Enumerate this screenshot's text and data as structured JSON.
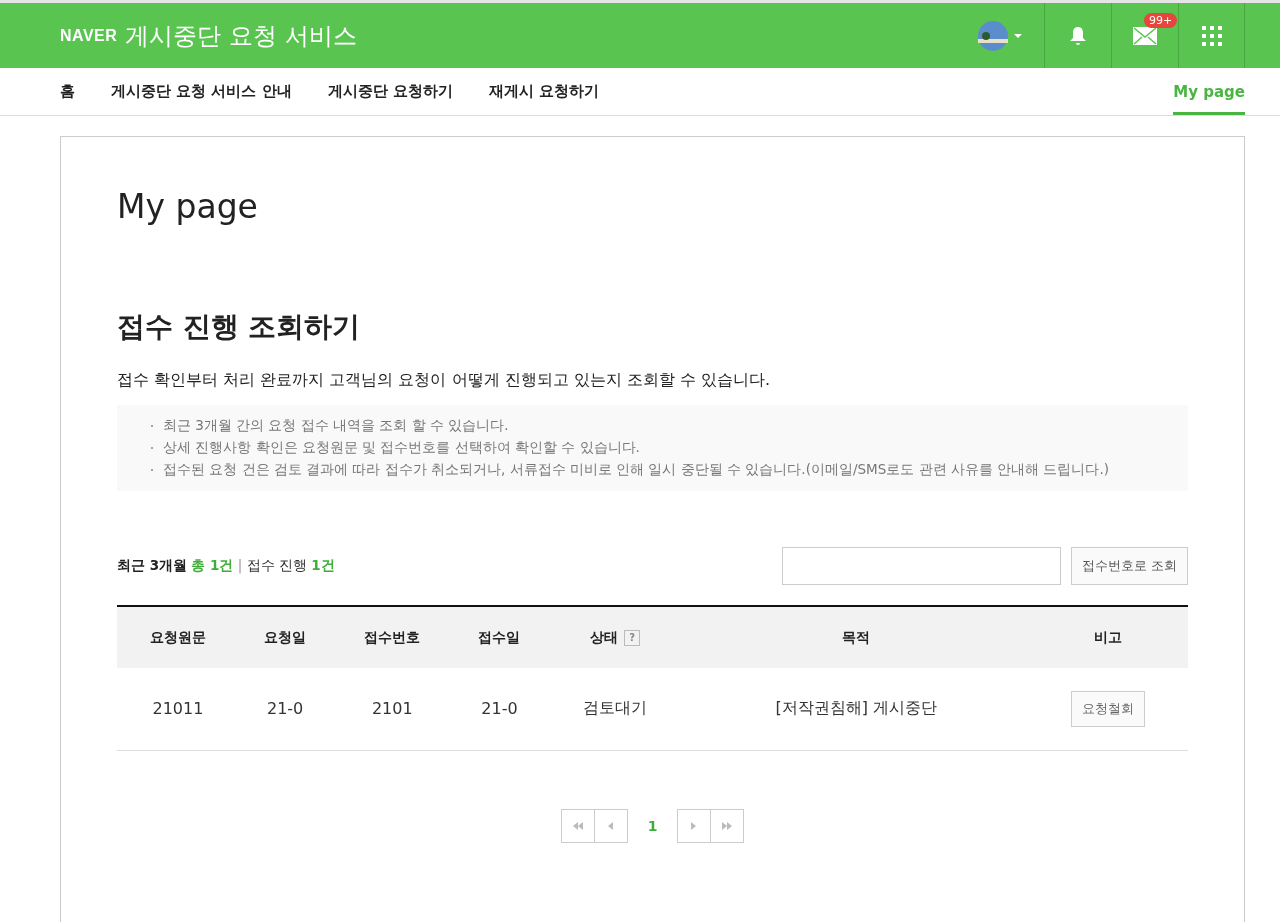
{
  "header": {
    "logo": "NAVER",
    "title": "게시중단 요청 서비스",
    "mail_badge": "99+"
  },
  "nav": {
    "items": [
      {
        "label": "홈",
        "selected": false
      },
      {
        "label": "게시중단 요청 서비스 안내",
        "selected": false
      },
      {
        "label": "게시중단 요청하기",
        "selected": false
      },
      {
        "label": "재게시 요청하기",
        "selected": false
      }
    ],
    "right": {
      "label": "My page",
      "selected": true
    }
  },
  "page_title": "My page",
  "section_title": "접수 진행 조회하기",
  "intro": "접수 확인부터 처리 완료까지 고객님의 요청이 어떻게 진행되고 있는지 조회할 수 있습니다.",
  "notes": [
    "최근 3개월 간의 요청 접수 내역을 조회 할 수 있습니다.",
    "상세 진행사항 확인은 요청원문 및 접수번호를 선택하여 확인할 수 있습니다.",
    "접수된 요청 건은 검토 결과에 따라 접수가 취소되거나, 서류접수 미비로 인해 일시 중단될 수 있습니다.(이메일/SMS로도 관련 사유를 안내해 드립니다.)"
  ],
  "summary": {
    "period": "최근 3개월",
    "total": "총 1건",
    "sep": "|",
    "progress_label": "접수 진행",
    "progress": "1건"
  },
  "search": {
    "button": "접수번호로 조회"
  },
  "table": {
    "columns": [
      "요청원문",
      "요청일",
      "접수번호",
      "접수일",
      "상태",
      "목적",
      "비고"
    ],
    "help": "?",
    "rows": [
      {
        "cells": [
          "21011",
          "21-0",
          "2101",
          "21-0",
          "검토대기",
          "[저작권침해] 게시중단"
        ],
        "action": "요청철회"
      }
    ]
  },
  "pagination": {
    "pages": [
      {
        "label": "1",
        "selected": true
      }
    ]
  }
}
